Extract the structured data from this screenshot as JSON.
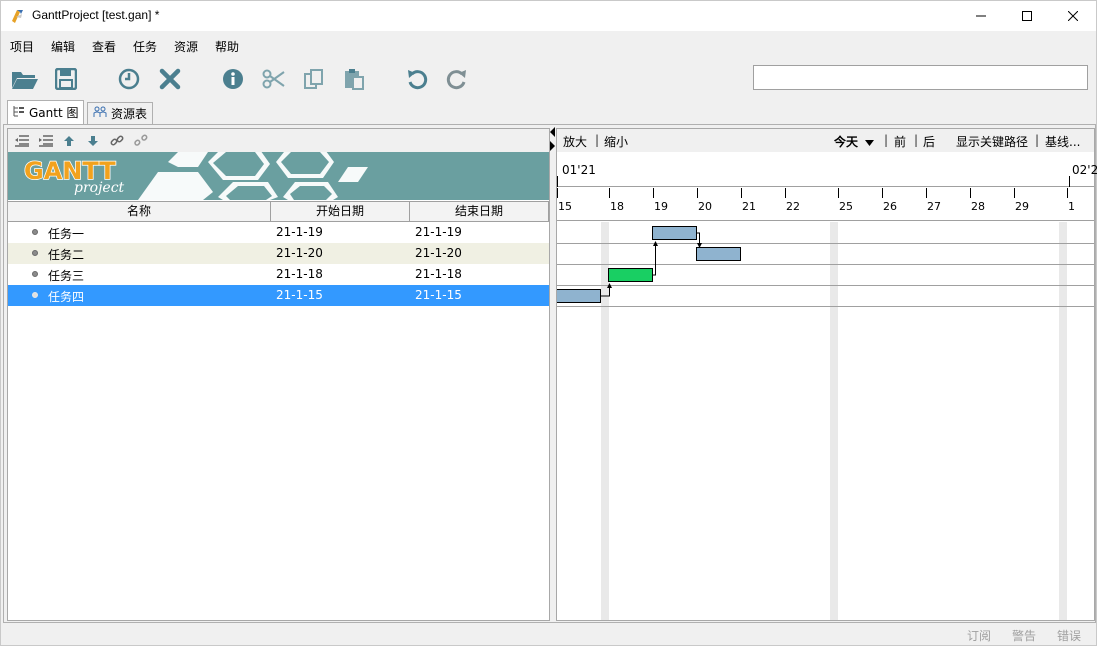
{
  "window": {
    "title": "GanttProject [test.gan] *"
  },
  "menu": [
    "项目",
    "编辑",
    "查看",
    "任务",
    "资源",
    "帮助"
  ],
  "toolbar": {
    "icons": [
      "open-folder-icon",
      "save-icon",
      "clock-icon",
      "delete-icon",
      "info-icon",
      "cut-icon",
      "copy-icon",
      "paste-icon",
      "undo-icon",
      "redo-icon"
    ],
    "search_value": ""
  },
  "tabs": [
    "Gantt 图",
    "资源表"
  ],
  "logo": {
    "main": "GANTT",
    "sub": "project"
  },
  "table": {
    "columns": [
      "名称",
      "开始日期",
      "结束日期"
    ],
    "rows": [
      {
        "name": "任务一",
        "start": "21-1-19",
        "end": "21-1-19"
      },
      {
        "name": "任务二",
        "start": "21-1-20",
        "end": "21-1-20"
      },
      {
        "name": "任务三",
        "start": "21-1-18",
        "end": "21-1-18"
      },
      {
        "name": "任务四",
        "start": "21-1-15",
        "end": "21-1-15"
      }
    ]
  },
  "chart_toolbar": {
    "zoom_in": "放大",
    "zoom_out": "缩小",
    "today": "今天",
    "prev": "前",
    "next": "后",
    "critical_path": "显示关键路径",
    "baseline": "基线..."
  },
  "timeline": {
    "month_left": "01'21",
    "month_right": "02'2",
    "days": [
      "15",
      "18",
      "19",
      "20",
      "21",
      "22",
      "25",
      "26",
      "27",
      "28",
      "29",
      "1"
    ]
  },
  "colors": {
    "task_bar": "#8fb3cf",
    "critical_bar": "#19cf63",
    "selection": "#3399ff",
    "weekend": "#e9e9e9"
  },
  "status": {
    "subscription": "订阅",
    "warning": "警告",
    "error": "错误"
  }
}
